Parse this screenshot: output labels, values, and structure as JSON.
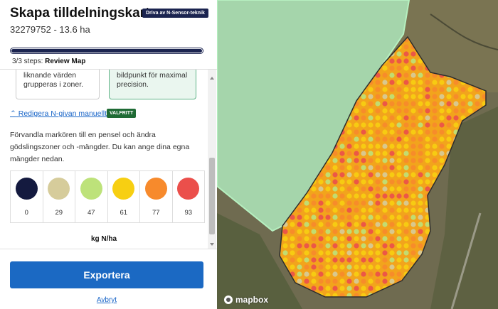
{
  "header": {
    "title": "Skapa tilldelningskarta",
    "badge": "Driva av N-Sensor-teknik",
    "subtitle": "32279752 - 13.6 ha"
  },
  "steps": {
    "progress": 1.0,
    "prefix": "3/3 steps:",
    "current": "Review Map"
  },
  "cards": {
    "left_text": "liknande värden grupperas i zoner.",
    "right_text": "bildpunkt för maximal precision."
  },
  "manual": {
    "link": "Redigera N-givan manuellt",
    "tag": "VALFRITT",
    "description": "Förvandla markören till en pensel och ändra gödslingszoner och -mängder. Du kan ange dina egna mängder nedan."
  },
  "swatches": [
    {
      "value": "0",
      "color": "#141a3f"
    },
    {
      "value": "29",
      "color": "#d6cc9b"
    },
    {
      "value": "47",
      "color": "#bde27a"
    },
    {
      "value": "61",
      "color": "#f7cf12"
    },
    {
      "value": "77",
      "color": "#f78a2c"
    },
    {
      "value": "93",
      "color": "#eb4f4b"
    }
  ],
  "unit_label": "kg N/ha",
  "export_label": "Exportera",
  "cancel_label": "Avbryt",
  "map": {
    "attribution": "mapbox"
  }
}
